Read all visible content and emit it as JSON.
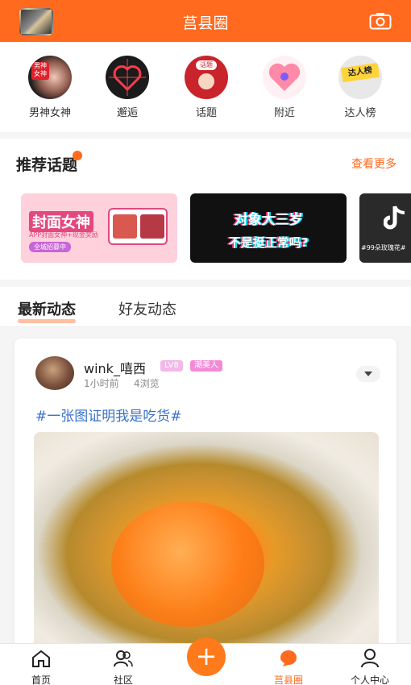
{
  "header": {
    "title": "莒县圈",
    "left_icon": "user-badge-icon",
    "right_icon": "camera-icon"
  },
  "quick_nav": [
    {
      "label": "男神女神",
      "icon": "gods-icon"
    },
    {
      "label": "邂逅",
      "icon": "encounter-icon"
    },
    {
      "label": "话题",
      "icon": "topic-icon"
    },
    {
      "label": "附近",
      "icon": "nearby-icon"
    },
    {
      "label": "达人榜",
      "icon": "ranking-icon"
    }
  ],
  "recommend": {
    "title": "推荐话题",
    "more": "查看更多",
    "cards": [
      {
        "title": "封面女神",
        "subtitle": "APP封面女神+现金奖励",
        "extra": "全城招募中"
      },
      {
        "title": "对象大三岁",
        "subtitle": "不是挺正常吗?"
      },
      {
        "title": "#99朵玫瑰花#"
      }
    ]
  },
  "feed_tabs": {
    "active": "最新动态",
    "inactive": "好友动态"
  },
  "post": {
    "username": "wink_嘻西",
    "level": "LV8",
    "tag": "潮美人",
    "time": "1小时前",
    "views": "4浏览",
    "topic": "#一张图证明我是吃货#",
    "image_alt": "蛋黄酥切面"
  },
  "tabbar": {
    "items": [
      {
        "label": "首页",
        "icon": "home-icon"
      },
      {
        "label": "社区",
        "icon": "community-icon"
      },
      {
        "label": "+",
        "icon": "plus-icon"
      },
      {
        "label": "莒县圈",
        "icon": "circle-icon"
      },
      {
        "label": "个人中心",
        "icon": "profile-icon"
      }
    ],
    "active": "莒县圈"
  },
  "colors": {
    "primary": "#ff6a1f",
    "topic_link": "#3a71c9"
  }
}
